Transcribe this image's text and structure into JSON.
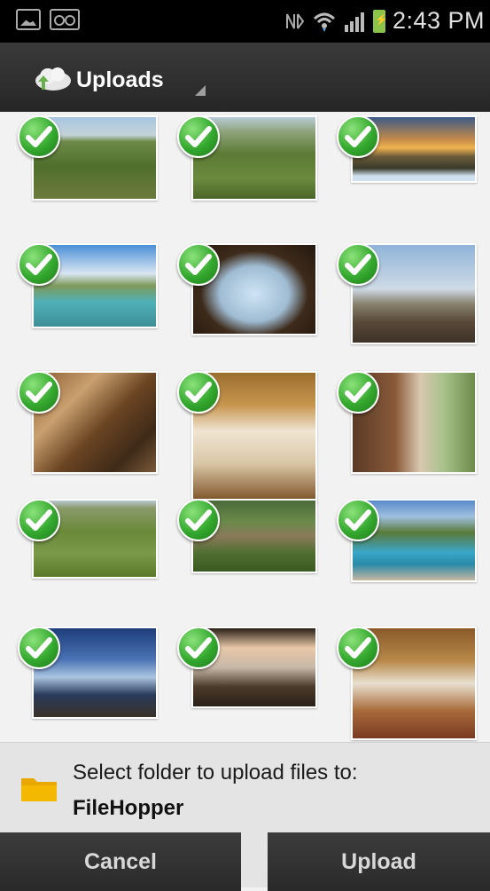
{
  "status_bar": {
    "time": "2:43 PM",
    "icons": [
      "gallery-icon",
      "voicemail-icon",
      "nfc-icon",
      "wifi-icon",
      "signal-icon",
      "battery-charging-icon"
    ],
    "battery_color": "#8bc34a"
  },
  "action_bar": {
    "title": "Uploads",
    "logo_icon": "cloud-upload-icon"
  },
  "gallery": {
    "selection_icon": "checkmark-icon",
    "photos": [
      {
        "description": "green hillside landscape",
        "selected": true
      },
      {
        "description": "aerial view of forested valley",
        "selected": true
      },
      {
        "description": "sunset over plains from lodge",
        "selected": true
      },
      {
        "description": "infinity pool with lounge chairs",
        "selected": true
      },
      {
        "description": "arched view with helicopter",
        "selected": true
      },
      {
        "description": "terrace overlooking plains",
        "selected": true
      },
      {
        "description": "lodge lounge interior",
        "selected": true
      },
      {
        "description": "canopy bed under thatched roof",
        "selected": true
      },
      {
        "description": "bathroom with stone bathtub",
        "selected": true
      },
      {
        "description": "green savanna landscape",
        "selected": true
      },
      {
        "description": "lodge buildings in forest",
        "selected": true
      },
      {
        "description": "pool with hammock",
        "selected": true
      },
      {
        "description": "two people on deck at dusk",
        "selected": true
      },
      {
        "description": "dining table on veranda",
        "selected": true
      },
      {
        "description": "thatched living room interior",
        "selected": true
      }
    ]
  },
  "folder": {
    "icon": "folder-icon",
    "prompt": "Select folder to upload files to:",
    "name": "FileHopper",
    "color": "#f5b800"
  },
  "buttons": {
    "cancel": "Cancel",
    "upload": "Upload"
  }
}
